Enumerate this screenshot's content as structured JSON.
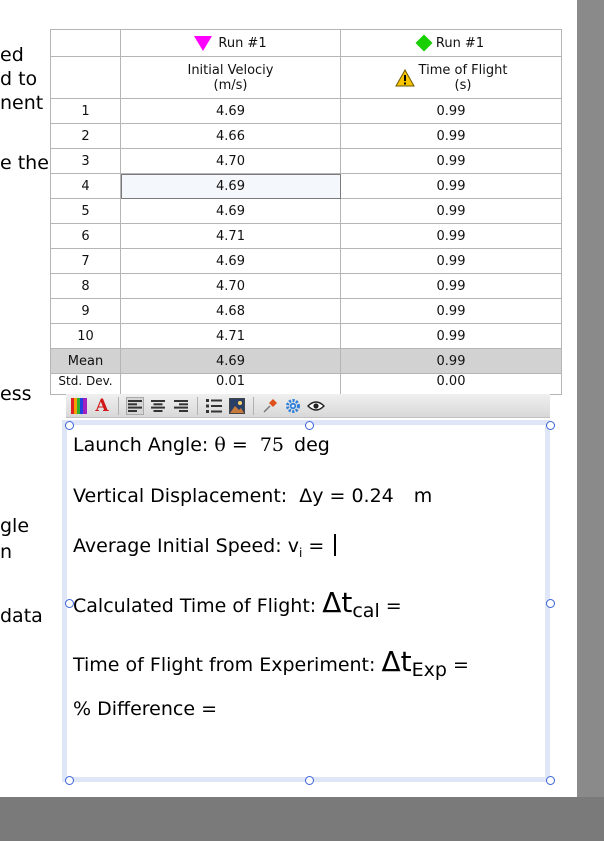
{
  "background_text": [
    "ed",
    "d to",
    "nent",
    "e the",
    "ess",
    "gle",
    "n",
    "data"
  ],
  "table": {
    "series": [
      {
        "run_label": "Run #1",
        "marker": "magenta-triangle-icon",
        "column": "Initial Velociy",
        "unit": "(m/s)"
      },
      {
        "run_label": "Run #1",
        "marker": "green-diamond-icon",
        "column": "Time of Flight",
        "unit": "(s)",
        "column_icon": "warning-icon"
      }
    ],
    "rows": [
      {
        "n": "1",
        "v": "4.69",
        "t": "0.99"
      },
      {
        "n": "2",
        "v": "4.66",
        "t": "0.99"
      },
      {
        "n": "3",
        "v": "4.70",
        "t": "0.99"
      },
      {
        "n": "4",
        "v": "4.69",
        "t": "0.99"
      },
      {
        "n": "5",
        "v": "4.69",
        "t": "0.99"
      },
      {
        "n": "6",
        "v": "4.71",
        "t": "0.99"
      },
      {
        "n": "7",
        "v": "4.69",
        "t": "0.99"
      },
      {
        "n": "8",
        "v": "4.70",
        "t": "0.99"
      },
      {
        "n": "9",
        "v": "4.68",
        "t": "0.99"
      },
      {
        "n": "10",
        "v": "4.71",
        "t": "0.99"
      }
    ],
    "selected_row": "4",
    "mean": {
      "label": "Mean",
      "v": "4.69",
      "t": "0.99"
    },
    "std": {
      "label": "Std. Dev.",
      "v": "0.01",
      "t": "0.00"
    }
  },
  "toolbar": {
    "buttons": [
      "color-palette-icon",
      "font-icon",
      "align-left-icon",
      "align-center-icon",
      "align-right-icon",
      "bullet-list-icon",
      "insert-image-icon",
      "pin-icon",
      "gear-icon",
      "eye-icon"
    ]
  },
  "textbox": {
    "line1": {
      "label": "Launch Angle: ",
      "symbol": "θ",
      "eq": " = ",
      "value": "75",
      "unit": " deg"
    },
    "line2": {
      "label": "Vertical Displacement: ",
      "symbol": "Δy",
      "eq": " = ",
      "value": "0.24",
      "unit": "m"
    },
    "line3": {
      "label": "Average Initial Speed: ",
      "symbol": "v",
      "sub": "i",
      "eq": " = "
    },
    "line4": {
      "label": "Calculated Time of Flight: ",
      "symbol": "Δt",
      "sub": "cal",
      "eq": " ="
    },
    "line5": {
      "label": "Time of Flight from Experiment: ",
      "symbol": "Δt",
      "sub": "Exp",
      "eq": " ="
    },
    "line6": {
      "label": "% Difference ="
    }
  }
}
